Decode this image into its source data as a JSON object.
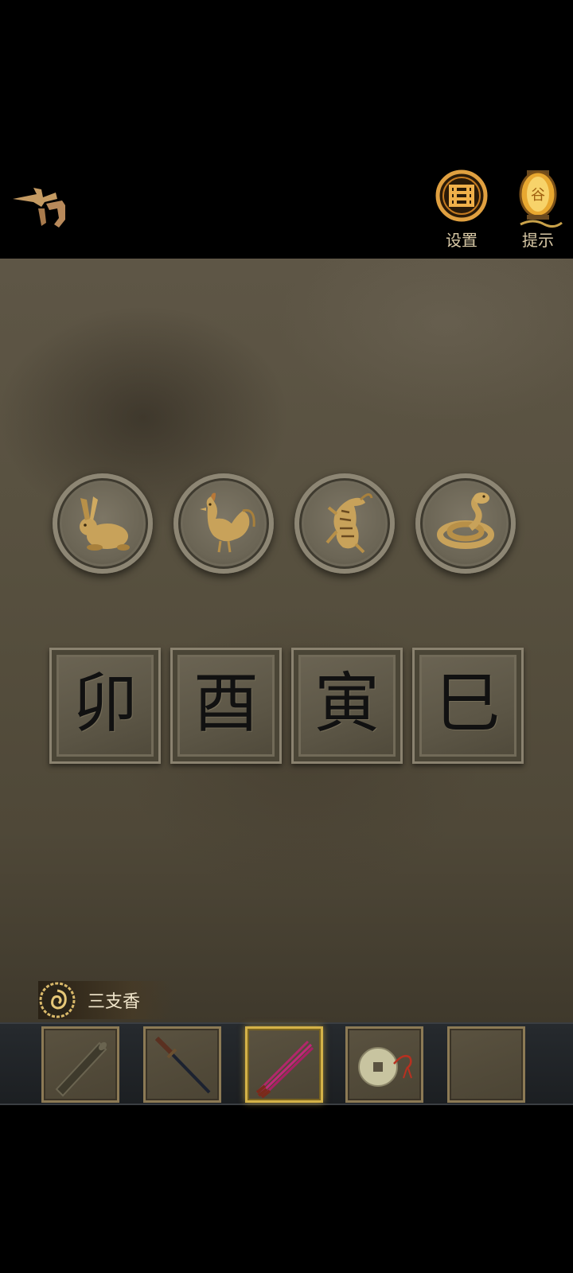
{
  "header": {
    "back_icon": "back-arrow-icon",
    "settings": {
      "label": "设置",
      "icon": "knot-emblem-icon"
    },
    "hint": {
      "label": "提示",
      "icon": "lantern-icon"
    }
  },
  "puzzle": {
    "medallions": [
      {
        "animal": "rabbit",
        "icon": "rabbit-icon"
      },
      {
        "animal": "rooster",
        "icon": "rooster-icon"
      },
      {
        "animal": "tiger",
        "icon": "tiger-icon"
      },
      {
        "animal": "snake",
        "icon": "snake-icon"
      }
    ],
    "tiles": [
      {
        "glyph": "卯"
      },
      {
        "glyph": "酉"
      },
      {
        "glyph": "寅"
      },
      {
        "glyph": "巳"
      }
    ]
  },
  "selected_item": {
    "name": "三支香",
    "icon": "swirl-emblem-icon"
  },
  "inventory": {
    "selected_index": 2,
    "slots": [
      {
        "item": "scroll-tube",
        "icon": "scroll-tube-icon"
      },
      {
        "item": "sword",
        "icon": "sword-icon"
      },
      {
        "item": "incense-sticks",
        "icon": "incense-sticks-icon"
      },
      {
        "item": "coin-on-string",
        "icon": "coin-icon"
      },
      {
        "item": "empty",
        "icon": ""
      }
    ]
  },
  "colors": {
    "accent_gold": "#c9a24a",
    "slot_border": "#8c7a55",
    "selected_border": "#d4b248",
    "wall": "#57503f"
  }
}
